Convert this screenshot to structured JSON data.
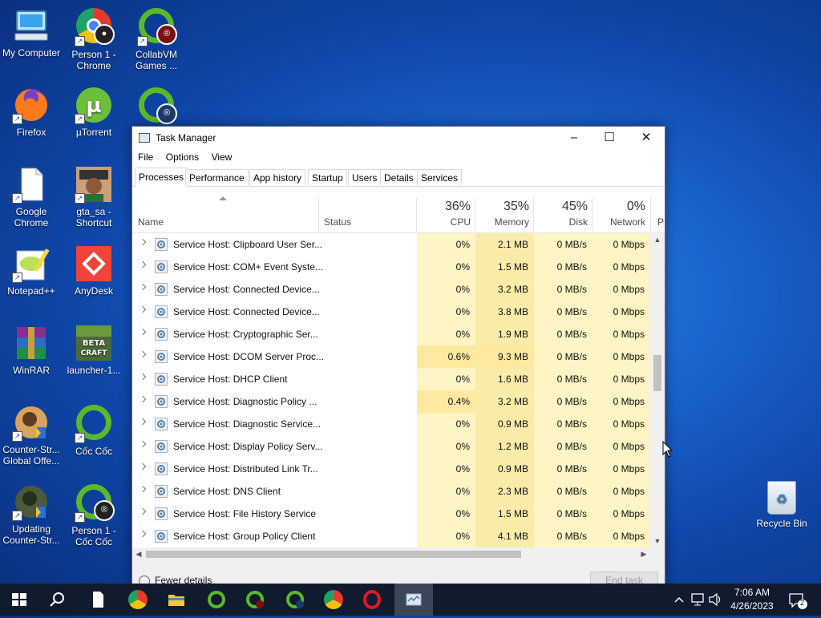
{
  "desktop": {
    "icons": [
      {
        "label": "My Computer"
      },
      {
        "label": "Person 1 - Chrome"
      },
      {
        "label": "CollabVM Games ..."
      },
      {
        "label": "Firefox"
      },
      {
        "label": "µTorrent"
      },
      {
        "label": "Google Chrome"
      },
      {
        "label": "gta_sa - Shortcut"
      },
      {
        "label": "Notepad++"
      },
      {
        "label": "AnyDesk"
      },
      {
        "label": "WinRAR"
      },
      {
        "label": "launcher-1..."
      },
      {
        "label": "Counter-Str... Global Offe..."
      },
      {
        "label": "Cốc Cốc"
      },
      {
        "label": "Updating Counter-Str..."
      },
      {
        "label": "Person 1 - Cốc Cốc"
      }
    ],
    "recycle_bin": "Recycle Bin"
  },
  "window": {
    "title": "Task Manager",
    "controls": {
      "minimize": "–",
      "maximize": "☐",
      "close": "✕"
    },
    "menu": [
      "File",
      "Options",
      "View"
    ],
    "tabs": [
      "Processes",
      "Performance",
      "App history",
      "Startup",
      "Users",
      "Details",
      "Services"
    ],
    "active_tab": "Processes",
    "columns": {
      "name": "Name",
      "status": "Status",
      "cpu": {
        "pct": "36%",
        "label": "CPU"
      },
      "memory": {
        "pct": "35%",
        "label": "Memory"
      },
      "disk": {
        "pct": "45%",
        "label": "Disk"
      },
      "network": {
        "pct": "0%",
        "label": "Network"
      },
      "power": "P"
    },
    "processes": [
      {
        "name": "Service Host: Clipboard User Ser...",
        "cpu": "0%",
        "memory": "2.1 MB",
        "disk": "0 MB/s",
        "network": "0 Mbps"
      },
      {
        "name": "Service Host: COM+ Event Syste...",
        "cpu": "0%",
        "memory": "1.5 MB",
        "disk": "0 MB/s",
        "network": "0 Mbps"
      },
      {
        "name": "Service Host: Connected Device...",
        "cpu": "0%",
        "memory": "3.2 MB",
        "disk": "0 MB/s",
        "network": "0 Mbps"
      },
      {
        "name": "Service Host: Connected Device...",
        "cpu": "0%",
        "memory": "3.8 MB",
        "disk": "0 MB/s",
        "network": "0 Mbps"
      },
      {
        "name": "Service Host: Cryptographic Ser...",
        "cpu": "0%",
        "memory": "1.9 MB",
        "disk": "0 MB/s",
        "network": "0 Mbps"
      },
      {
        "name": "Service Host: DCOM Server Proc...",
        "cpu": "0.6%",
        "memory": "9.3 MB",
        "disk": "0 MB/s",
        "network": "0 Mbps"
      },
      {
        "name": "Service Host: DHCP Client",
        "cpu": "0%",
        "memory": "1.6 MB",
        "disk": "0 MB/s",
        "network": "0 Mbps"
      },
      {
        "name": "Service Host: Diagnostic Policy ...",
        "cpu": "0.4%",
        "memory": "3.2 MB",
        "disk": "0 MB/s",
        "network": "0 Mbps"
      },
      {
        "name": "Service Host: Diagnostic Service...",
        "cpu": "0%",
        "memory": "0.9 MB",
        "disk": "0 MB/s",
        "network": "0 Mbps"
      },
      {
        "name": "Service Host: Display Policy Serv...",
        "cpu": "0%",
        "memory": "1.2 MB",
        "disk": "0 MB/s",
        "network": "0 Mbps"
      },
      {
        "name": "Service Host: Distributed Link Tr...",
        "cpu": "0%",
        "memory": "0.9 MB",
        "disk": "0 MB/s",
        "network": "0 Mbps"
      },
      {
        "name": "Service Host: DNS Client",
        "cpu": "0%",
        "memory": "2.3 MB",
        "disk": "0 MB/s",
        "network": "0 Mbps"
      },
      {
        "name": "Service Host: File History Service",
        "cpu": "0%",
        "memory": "1.5 MB",
        "disk": "0 MB/s",
        "network": "0 Mbps"
      },
      {
        "name": "Service Host: Group Policy Client",
        "cpu": "0%",
        "memory": "4.1 MB",
        "disk": "0 MB/s",
        "network": "0 Mbps"
      }
    ],
    "footer": {
      "fewer_details": "Fewer details",
      "end_task": "End task"
    }
  },
  "colors": {
    "cell_light": "#fff4c4",
    "cell_medium": "#f9eca8",
    "cell_strong": "#ffe9a0"
  },
  "taskbar": {
    "clock_time": "7:06 AM",
    "clock_date": "4/26/2023",
    "notification_count": "2"
  }
}
